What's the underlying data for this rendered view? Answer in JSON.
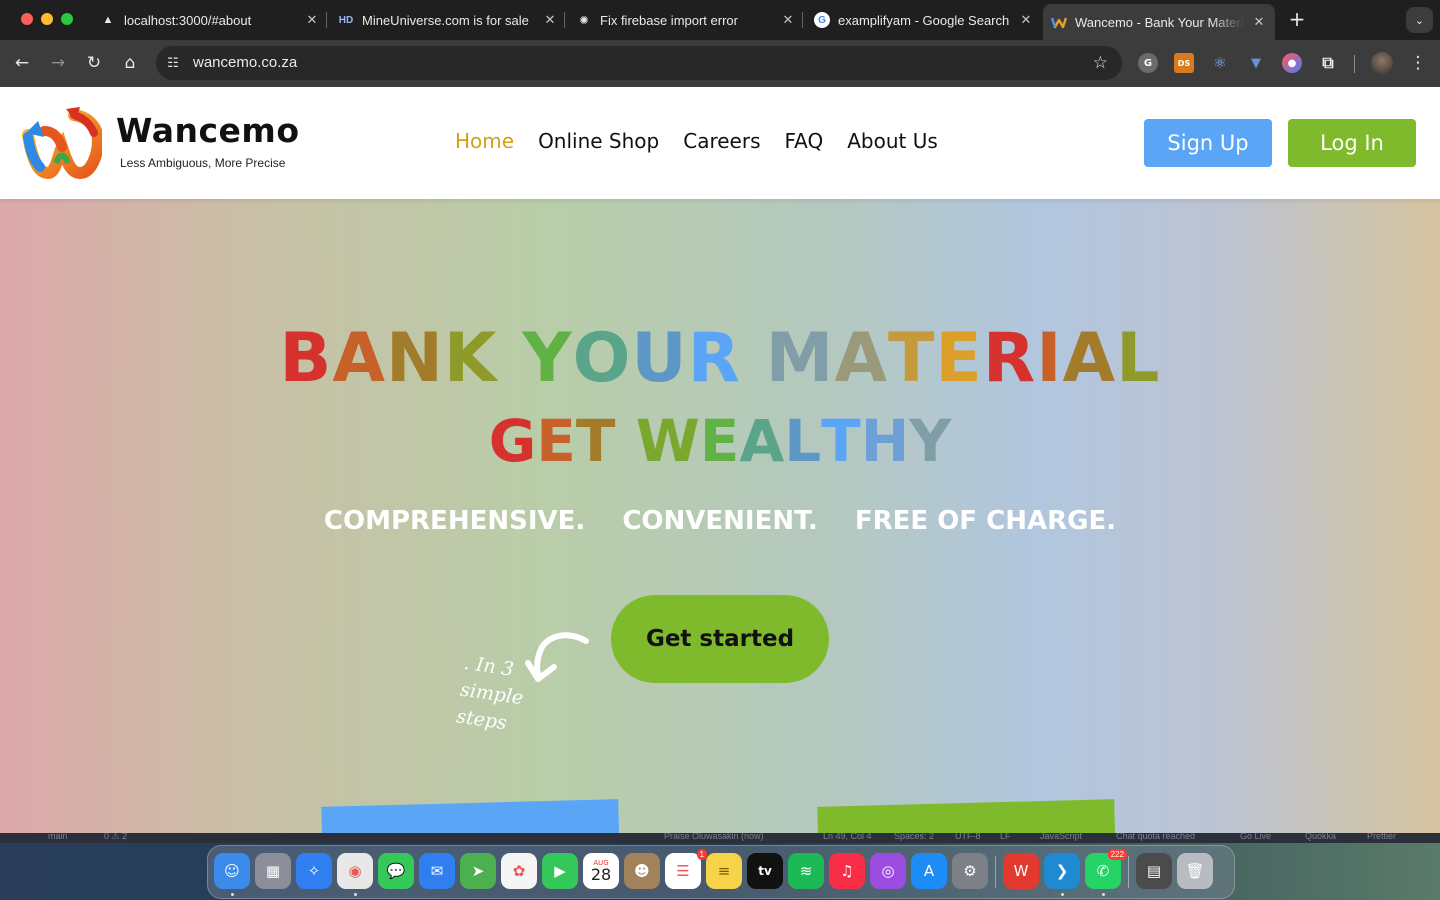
{
  "browser": {
    "tabs": [
      {
        "title": "localhost:3000/#about",
        "favicon": "triangle-icon"
      },
      {
        "title": "MineUniverse.com is for sale",
        "favicon": "hd-icon"
      },
      {
        "title": "Fix firebase import error",
        "favicon": "openai-icon"
      },
      {
        "title": "examplifyam - Google Search",
        "favicon": "google-icon"
      },
      {
        "title": "Wancemo - Bank Your Material",
        "favicon": "wancemo-icon",
        "active": true
      }
    ],
    "url": "wancemo.co.za",
    "extensions": [
      {
        "name": "grammarly-icon",
        "label": "G"
      },
      {
        "name": "ds-icon",
        "label": "DS"
      },
      {
        "name": "react-devtools-icon",
        "label": "⚛"
      },
      {
        "name": "shield-extension-icon",
        "label": "▼"
      },
      {
        "name": "color-picker-icon",
        "label": "●"
      },
      {
        "name": "extensions-puzzle-icon",
        "label": "⧉"
      }
    ]
  },
  "site": {
    "brand": {
      "name": "Wancemo",
      "tagline": "Less Ambiguous, More Precise"
    },
    "nav": [
      {
        "label": "Home",
        "active": true
      },
      {
        "label": "Online Shop"
      },
      {
        "label": "Careers"
      },
      {
        "label": "FAQ"
      },
      {
        "label": "About Us"
      }
    ],
    "signup_label": "Sign Up",
    "login_label": "Log In",
    "hero": {
      "title": "BANK YOUR MATERIAL",
      "subtitle": "GET WEALTHY",
      "taglines": [
        "COMPREHENSIVE.",
        "CONVENIENT.",
        "FREE OF CHARGE."
      ],
      "cta": "Get started",
      "note": ". In 3\nsimple\nsteps"
    },
    "colors": {
      "accent_gold": "#d4a017",
      "signup_blue": "#5aa5f6",
      "login_green": "#7fba2c"
    }
  },
  "vscode_status": [
    "main",
    "0 ⚠ 2",
    "Praise Oluwasakin (now)",
    "Ln 49, Col 4",
    "Spaces: 2",
    "UTF-8",
    "LF",
    "JavaScript",
    "Chat quota reached",
    "Go Live",
    "Quokka",
    "Prettier"
  ],
  "dock": {
    "apps": [
      {
        "name": "finder-icon"
      },
      {
        "name": "launchpad-icon"
      },
      {
        "name": "safari-icon"
      },
      {
        "name": "chrome-icon"
      },
      {
        "name": "messages-icon"
      },
      {
        "name": "mail-icon"
      },
      {
        "name": "maps-icon"
      },
      {
        "name": "photos-icon"
      },
      {
        "name": "facetime-icon"
      },
      {
        "name": "calendar-icon",
        "month": "AUG",
        "day": "28"
      },
      {
        "name": "contacts-icon"
      },
      {
        "name": "reminders-icon",
        "badge": "1"
      },
      {
        "name": "notes-icon"
      },
      {
        "name": "appletv-icon",
        "label": "tv"
      },
      {
        "name": "spotify-icon"
      },
      {
        "name": "music-icon"
      },
      {
        "name": "podcasts-icon"
      },
      {
        "name": "appstore-icon"
      },
      {
        "name": "system-settings-icon"
      },
      {
        "name": "wps-office-icon"
      },
      {
        "name": "vscode-icon"
      },
      {
        "name": "whatsapp-icon",
        "badge": "222"
      },
      {
        "name": "document-preview-icon"
      },
      {
        "name": "trash-icon"
      }
    ]
  }
}
